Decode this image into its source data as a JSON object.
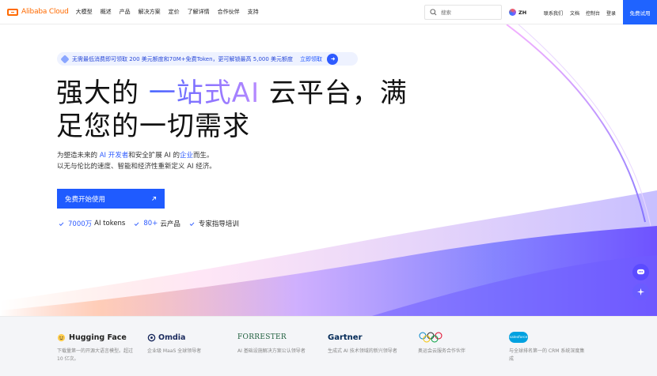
{
  "nav": {
    "logo_text": "Alibaba Cloud",
    "items": [
      "大模型",
      "概述",
      "产品",
      "解决方案",
      "定价",
      "了解详情",
      "合作伙伴",
      "支持"
    ],
    "search_placeholder": "搜索",
    "lang": "ZH",
    "right_items": [
      "联系我们",
      "文档",
      "控制台",
      "登录"
    ],
    "cta": "免费试用"
  },
  "hero": {
    "promo_text": "无需最低消费即可领取 200 美元额度和70M+免费Token，更可解锁最高 5,000 美元额度",
    "promo_link": "立即领取",
    "headline_part1": "强大的 ",
    "headline_highlight": "一站式AI",
    "headline_part2": " 云平台，满",
    "headline_line2": "足您的一切需求",
    "desc_1": "为塑造未来的 ",
    "desc_hl1": "AI 开发者",
    "desc_2": "和安全扩展 AI 的",
    "desc_hl2": "企业",
    "desc_3": "而生。",
    "desc_line2": "以无与伦比的速度、智能和经济性重新定义 AI 经济。",
    "cta": "免费开始使用",
    "checks": [
      {
        "num": "7000万",
        "text": "AI tokens"
      },
      {
        "num": "80+",
        "text": "云产品"
      },
      {
        "num": "",
        "text": "专家指导培训"
      }
    ]
  },
  "partners": [
    {
      "name": "Hugging Face",
      "desc": "下载量第一的开源大语言模型。超过 10 亿次。"
    },
    {
      "name": "Omdia",
      "desc": "企业级 MaaS 全球领导者"
    },
    {
      "name": "FORRESTER",
      "desc": "AI 基础设施解决方案公认领导者"
    },
    {
      "name": "Gartner",
      "desc": "生成式 AI 技术领域的新兴领导者"
    },
    {
      "name": "",
      "desc": "奥运会云服务合作伙伴"
    },
    {
      "name": "salesforce",
      "desc": "与全球排名第一的 CRM 系统深度集成"
    }
  ],
  "colors": {
    "brand": "#ff6a00",
    "primary": "#1f5bff",
    "promo_bg": "#eef2ff"
  }
}
